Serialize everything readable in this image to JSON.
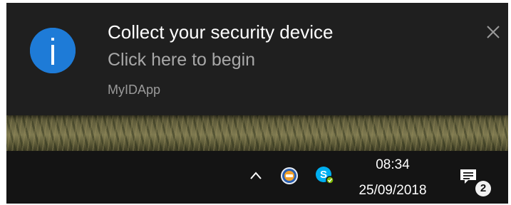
{
  "toast": {
    "title": "Collect your security device",
    "body": "Click here to begin",
    "source": "MyIDApp",
    "icon": "info-icon",
    "icon_color": "#1e7bd7"
  },
  "taskbar": {
    "tray_icons": [
      "chevron-up-icon",
      "myid-app-icon",
      "skype-icon"
    ],
    "clock": {
      "time": "08:34",
      "date": "25/09/2018"
    },
    "action_center": {
      "icon": "action-center-icon",
      "badge_count": "2"
    }
  }
}
